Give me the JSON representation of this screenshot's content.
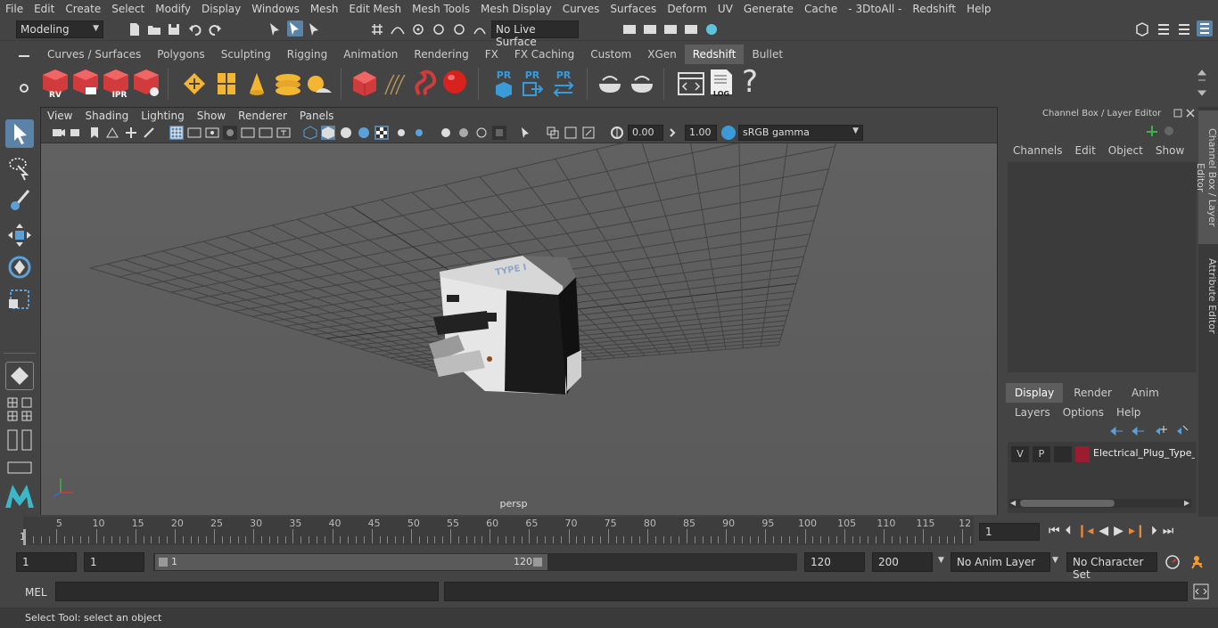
{
  "menubar": [
    "File",
    "Edit",
    "Create",
    "Select",
    "Modify",
    "Display",
    "Windows",
    "Mesh",
    "Edit Mesh",
    "Mesh Tools",
    "Mesh Display",
    "Curves",
    "Surfaces",
    "Deform",
    "UV",
    "Generate",
    "Cache",
    "- 3DtoAll -",
    "Redshift",
    "Help"
  ],
  "status": {
    "mode": "Modeling",
    "live_surface": "No Live Surface"
  },
  "shelf_tabs": [
    "Curves / Surfaces",
    "Polygons",
    "Sculpting",
    "Rigging",
    "Animation",
    "Rendering",
    "FX",
    "FX Caching",
    "Custom",
    "XGen",
    "Redshift",
    "Bullet"
  ],
  "shelf_active": "Redshift",
  "shelf_labels": {
    "rv": "RV",
    "ipr": "IPR",
    "pr": "PR",
    "log": "LOG",
    "help": "?"
  },
  "viewport": {
    "menu": [
      "View",
      "Shading",
      "Lighting",
      "Show",
      "Renderer",
      "Panels"
    ],
    "exposure": "0.00",
    "gamma": "1.00",
    "colorspace": "sRGB gamma",
    "camera": "persp",
    "plug_text": "TYPE I"
  },
  "channel_box": {
    "title": "Channel Box / Layer Editor",
    "menu": [
      "Channels",
      "Edit",
      "Object",
      "Show"
    ]
  },
  "layer_editor": {
    "tabs": [
      "Display",
      "Render",
      "Anim"
    ],
    "menu": [
      "Layers",
      "Options",
      "Help"
    ],
    "layer": {
      "v": "V",
      "p": "P",
      "name": "Electrical_Plug_Type_I",
      "color": "#9b1b30"
    }
  },
  "side_tabs": [
    "Channel Box / Layer Editor",
    "Attribute Editor"
  ],
  "timeline": {
    "ticks": [
      "5",
      "10",
      "15",
      "20",
      "25",
      "30",
      "35",
      "40",
      "45",
      "50",
      "55",
      "60",
      "65",
      "70",
      "75",
      "80",
      "85",
      "90",
      "95",
      "100",
      "105",
      "110",
      "115",
      "12"
    ],
    "start_marker": "1",
    "current_frame": "1"
  },
  "range": {
    "start": "1",
    "playback_start": "1",
    "slider_start": "1",
    "slider_end": "120",
    "playback_end": "120",
    "end": "200",
    "anim_layer": "No Anim Layer",
    "character_set": "No Character Set"
  },
  "cmd": {
    "label": "MEL"
  },
  "help_line": "Select Tool: select an object"
}
